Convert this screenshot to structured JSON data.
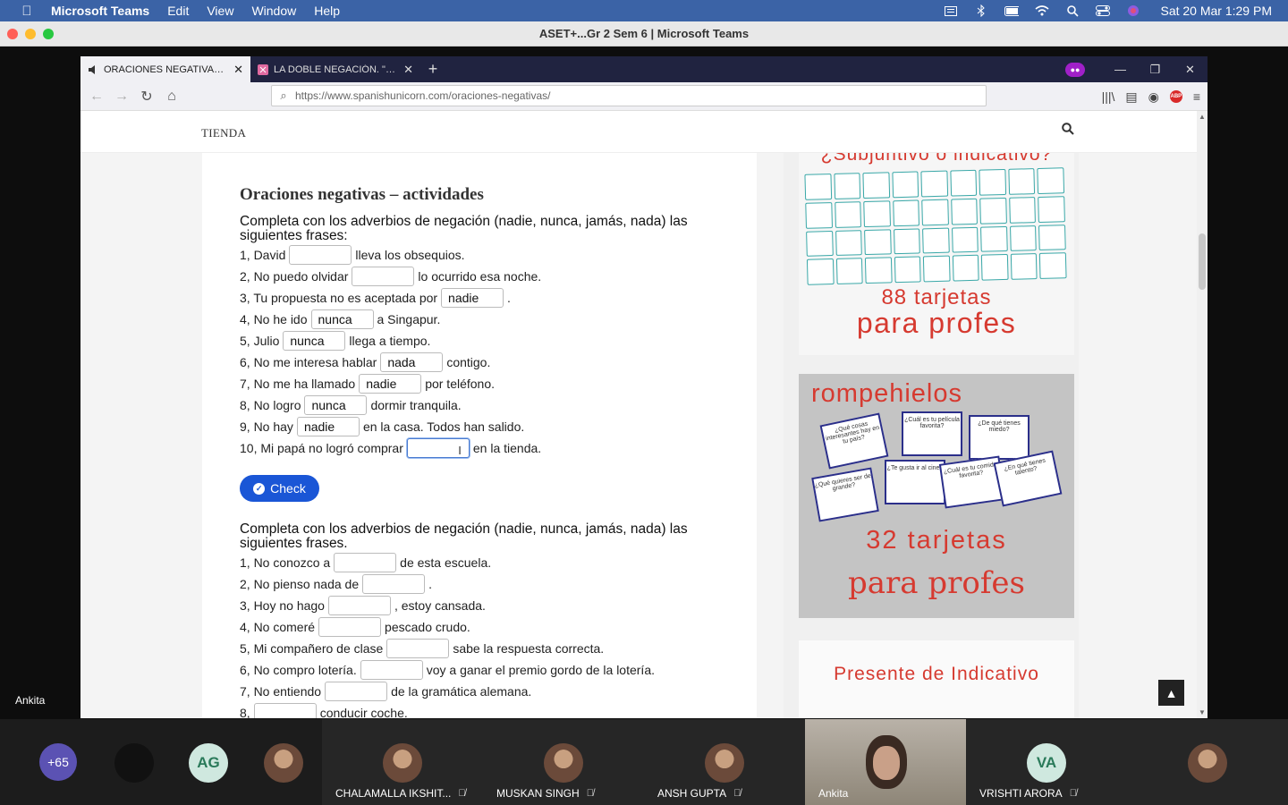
{
  "menubar": {
    "app": "Microsoft Teams",
    "items": [
      "Edit",
      "View",
      "Window",
      "Help"
    ],
    "clock": "Sat 20 Mar  1:29 PM"
  },
  "window": {
    "title": "ASET+...Gr 2 Sem 6 | Microsoft Teams"
  },
  "browser": {
    "tabs": [
      {
        "label": "ORACIONES NEGATIVAS: no, nunca…"
      },
      {
        "label": "LA DOBLE NEGACIÓN. \"No+nunca…"
      }
    ],
    "url": "https://www.spanishunicorn.com/oraciones-negativas/",
    "abp": "ABP"
  },
  "site": {
    "nav_tienda": "TIENDA",
    "heading": "Oraciones negativas – actividades",
    "instructions_1": "Completa con los adverbios de negación (nadie, nunca, jamás, nada) las siguientes frases:",
    "instructions_2": "Completa con los adverbios de negación (nadie, nunca, jamás, nada) las siguientes frases.",
    "check_label": "Check",
    "exercise1": [
      {
        "pre": "1, David",
        "value": "",
        "post": "lleva los obsequios."
      },
      {
        "pre": "2, No puedo olvidar",
        "value": "",
        "post": "lo ocurrido esa noche."
      },
      {
        "pre": "3, Tu propuesta no es aceptada por",
        "value": "nadie",
        "post": "."
      },
      {
        "pre": "4, No he ido",
        "value": "nunca",
        "post": "a Singapur."
      },
      {
        "pre": "5, Julio",
        "value": "nunca",
        "post": "llega a tiempo."
      },
      {
        "pre": "6, No me interesa hablar",
        "value": "nada",
        "post": "contigo."
      },
      {
        "pre": "7,  No me ha llamado",
        "value": "nadie",
        "post": "por teléfono."
      },
      {
        "pre": "8, No logro",
        "value": "nunca",
        "post": "dormir tranquila."
      },
      {
        "pre": "9, No hay",
        "value": "nadie",
        "post": "en la casa. Todos han salido."
      },
      {
        "pre": "10, Mi papá no logró comprar",
        "value": "",
        "post": "en la tienda."
      }
    ],
    "exercise2": [
      {
        "pre": "1, No conozco a",
        "value": "",
        "post": "de esta escuela."
      },
      {
        "pre": "2, No pienso nada de",
        "value": "",
        "post": "."
      },
      {
        "pre": "3, Hoy no hago",
        "value": "",
        "post": ", estoy cansada."
      },
      {
        "pre": "4, No comeré",
        "value": "",
        "post": "pescado crudo."
      },
      {
        "pre": "5, Mi compañero de clase",
        "value": "",
        "post": "sabe la respuesta correcta."
      },
      {
        "pre": "6, No compro lotería.",
        "value": "",
        "post": "voy a ganar el premio gordo de la lotería."
      },
      {
        "pre": "7, No entiendo",
        "value": "",
        "post": "de la gramática alemana."
      },
      {
        "pre": "8,",
        "value": "",
        "post": "conducir coche."
      }
    ],
    "ad1": {
      "title": "¿Subjuntivo o indicativo?",
      "count": "88 tarjetas",
      "sub": "para profes"
    },
    "ad2": {
      "title": "rompehielos",
      "cards": [
        "¿Qué cosas interesantes hay en tu país?",
        "¿Cuál es tu película favorita?",
        "¿De qué tienes miedo?",
        "¿Qué quieres ser de grande?",
        "¿Te gusta ir al cine?",
        "¿Cuál es tu comida favorita?",
        "¿En qué tienes talento?"
      ],
      "count": "32 tarjetas",
      "sub": "para profes"
    },
    "ad3": {
      "title": "Presente de Indicativo"
    }
  },
  "presenter_name": "Ankita",
  "participants": [
    {
      "initials": "+65",
      "color": "#5b52b3"
    },
    {
      "initials": "",
      "color": "#111111"
    },
    {
      "initials": "AG",
      "color": "#cfe8df"
    },
    {
      "initials": "",
      "color": "#8a5b3c"
    },
    {
      "name": "CHALAMALLA IKSHIT..."
    },
    {
      "name": "MUSKAN SINGH"
    },
    {
      "name": "ANSH GUPTA"
    },
    {
      "name": "Ankita"
    },
    {
      "name": "VRISHTI ARORA",
      "initials": "VA",
      "color": "#cfe8df"
    },
    {
      "name": ""
    }
  ]
}
